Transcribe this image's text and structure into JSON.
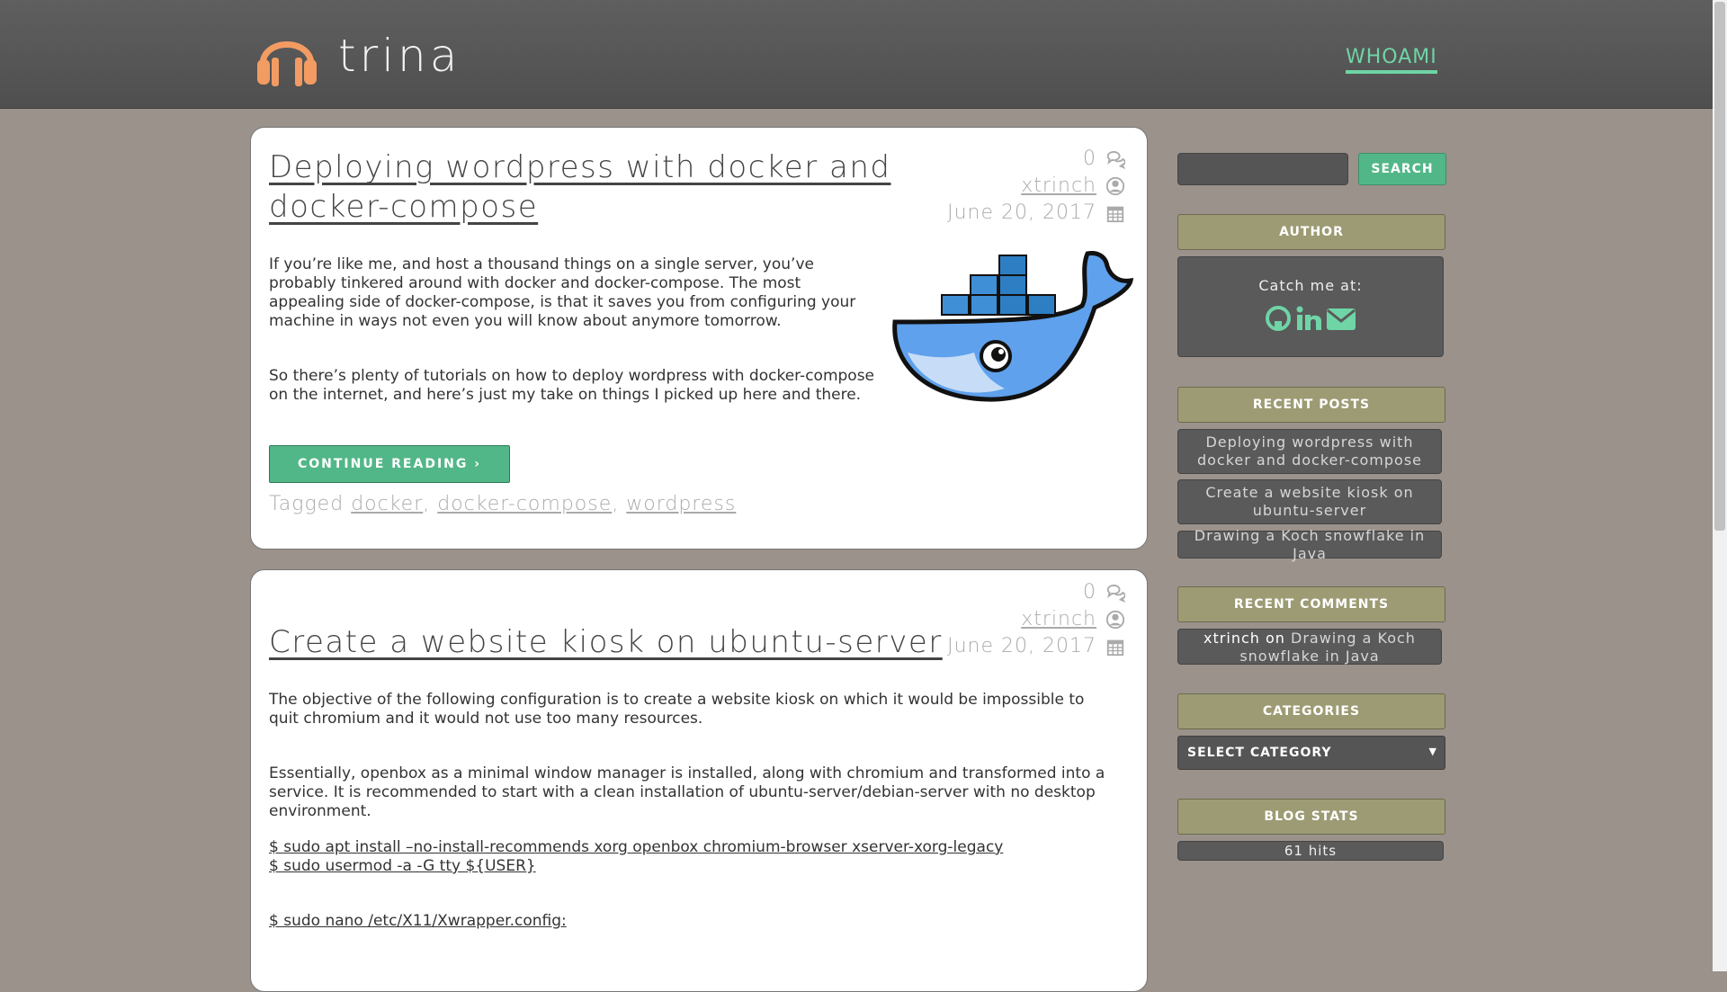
{
  "header": {
    "site_title": "trina",
    "nav_link": "WHOAMI",
    "logo_icon": "headphones-icon",
    "accent_color": "#6fd4a6",
    "logo_color": "#f29b62"
  },
  "posts": [
    {
      "title_line1": "Deploying wordpress with docker and",
      "title_line2": "docker-compose",
      "comments": "0",
      "author": "xtrinch",
      "date": "June 20, 2017",
      "paragraphs": [
        "If you’re like me, and host a thousand things on a single server, you’ve probably tinkered around with docker and docker-compose. The most appealing side of docker-compose, is that it saves you from configuring your machine in ways not even you will know about anymore tomorrow.",
        "So there’s plenty of tutorials on how to deploy wordpress with docker-compose on the internet, and here’s just my take on things I picked up here and there."
      ],
      "continue_label": "CONTINUE READING ›",
      "tagged_label": "Tagged",
      "tags": [
        "docker",
        "docker-compose",
        "wordpress"
      ],
      "image_icon": "docker-whale-icon"
    },
    {
      "title": "Create a website kiosk on ubuntu-server",
      "comments": "0",
      "author": "xtrinch",
      "date": "June 20, 2017",
      "paragraphs": [
        "The objective of the following configuration is to create a website kiosk on which it would be impossible to quit chromium and it would not use too many resources.",
        "Essentially, openbox as a minimal window manager is installed, along with chromium and transformed into a service. It is recommended to start with a clean installation of ubuntu-server/debian-server with no desktop environment."
      ],
      "code_lines": [
        "$ sudo apt install –no-install-recommends xorg openbox chromium-browser xserver-xorg-legacy",
        "$ sudo usermod -a -G tty ${USER}"
      ],
      "code_line3": "$ sudo nano /etc/X11/Xwrapper.config:"
    }
  ],
  "sidebar": {
    "search_placeholder": "",
    "search_button": "SEARCH",
    "author_title": "AUTHOR",
    "catch_me": "Catch me at:",
    "social_icons": [
      "github-icon",
      "linkedin-icon",
      "envelope-icon"
    ],
    "recent_posts_title": "RECENT POSTS",
    "recent_posts": [
      "Deploying wordpress with docker and docker-compose",
      "Create a website kiosk on ubuntu-server",
      "Drawing a Koch snowflake in Java"
    ],
    "recent_comments_title": "RECENT COMMENTS",
    "recent_comment_author": "xtrinch",
    "recent_comment_on": "on",
    "recent_comment_post": "Drawing a Koch snowflake in Java",
    "categories_title": "CATEGORIES",
    "category_select": "SELECT CATEGORY",
    "blog_stats_title": "BLOG STATS",
    "hits": "61 hits"
  }
}
